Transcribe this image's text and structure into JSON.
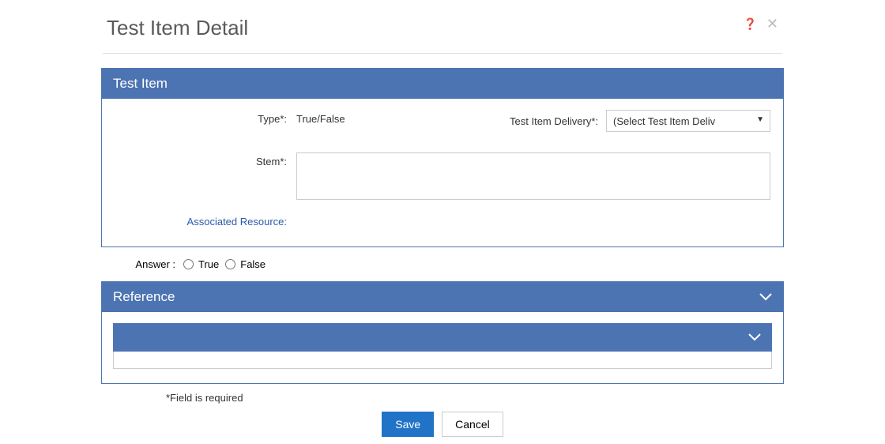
{
  "page": {
    "title": "Test Item Detail"
  },
  "header_actions": {
    "help_icon": "help-icon",
    "close_icon": "close-icon"
  },
  "test_item": {
    "section_title": "Test Item",
    "type": {
      "label": "Type*:",
      "value": "True/False"
    },
    "delivery": {
      "label": "Test Item Delivery*:",
      "selected": "(Select Test Item Deliv"
    },
    "stem": {
      "label": "Stem*:",
      "value": ""
    },
    "associated_resource": {
      "label": "Associated Resource:"
    }
  },
  "answer": {
    "label": "Answer :",
    "options": {
      "true": "True",
      "false": "False"
    }
  },
  "reference": {
    "section_title": "Reference"
  },
  "footer": {
    "required_note": "*Field is required",
    "save": "Save",
    "cancel": "Cancel"
  }
}
